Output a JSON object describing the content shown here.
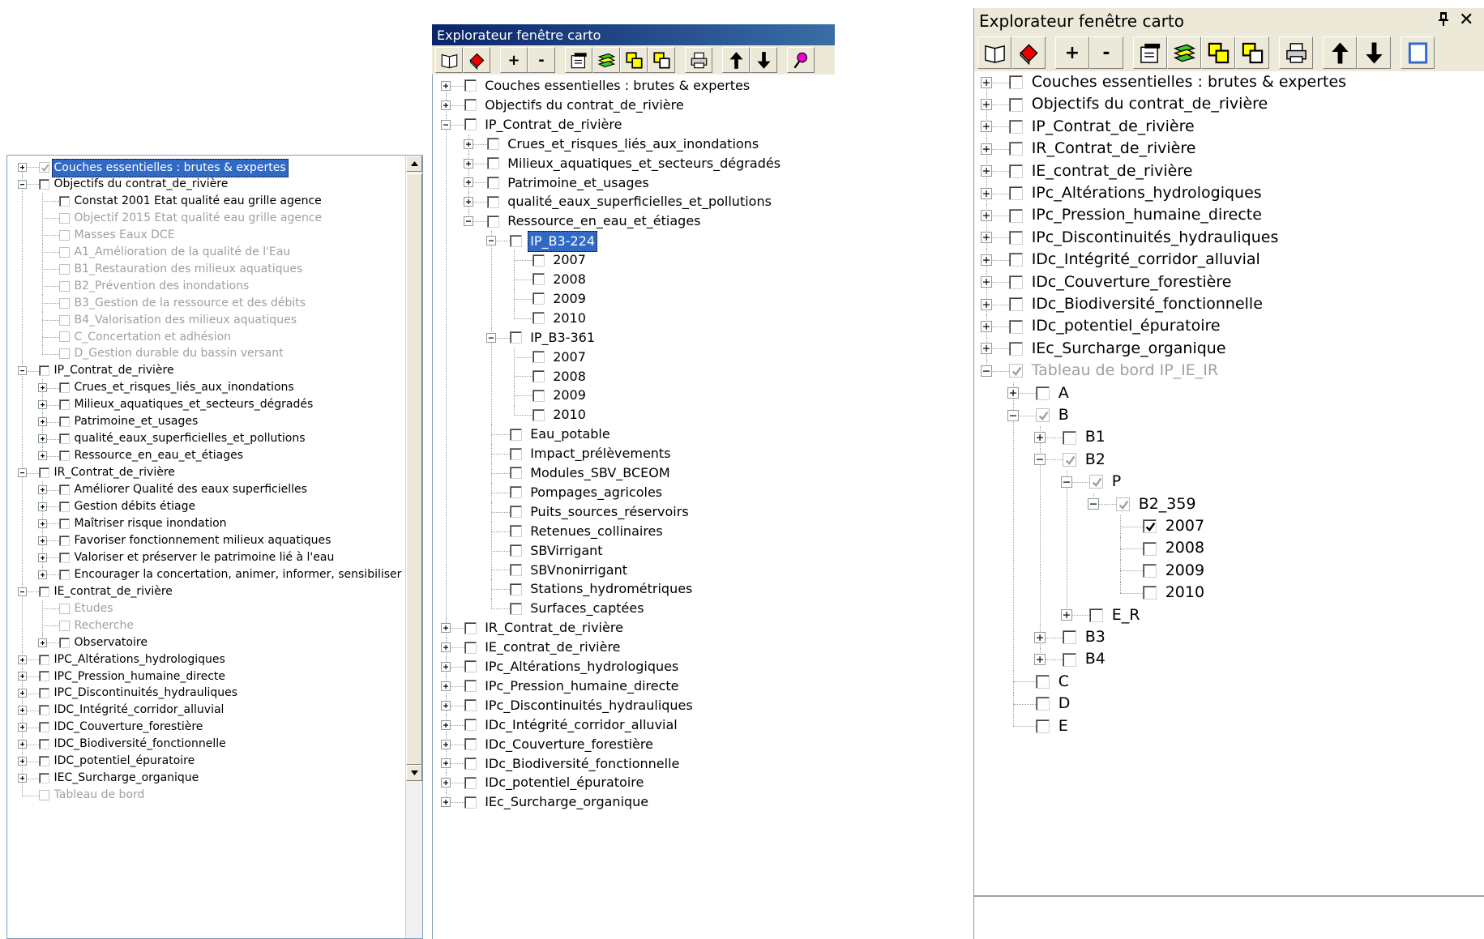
{
  "colors": {
    "titlebar_active": "#0a246a",
    "titlebar_gradient_end": "#3a6ea5",
    "selection": "#316ac5",
    "disabled_text": "#a0a0a0",
    "panel_bg": "#ece9d8"
  },
  "panel1": {
    "items": [
      {
        "level": 0,
        "exp": "+",
        "checked": "dis",
        "label": "Couches essentielles : brutes & expertes",
        "selected": true
      },
      {
        "level": 0,
        "exp": "-",
        "checked": false,
        "label": "Objectifs du contrat_de_rivière"
      },
      {
        "level": 1,
        "exp": "",
        "checked": false,
        "label": "Constat 2001 Etat qualité eau grille agence"
      },
      {
        "level": 1,
        "exp": "",
        "checked": "dis",
        "label": "Objectif 2015 Etat qualité eau grille agence",
        "disabled": true
      },
      {
        "level": 1,
        "exp": "",
        "checked": "dis",
        "label": "Masses Eaux DCE",
        "disabled": true
      },
      {
        "level": 1,
        "exp": "",
        "checked": "dis",
        "label": "A1_Amélioration de la qualité de l'Eau",
        "disabled": true
      },
      {
        "level": 1,
        "exp": "",
        "checked": "dis",
        "label": "B1_Restauration des milieux aquatiques",
        "disabled": true
      },
      {
        "level": 1,
        "exp": "",
        "checked": "dis",
        "label": "B2_Prévention des inondations",
        "disabled": true
      },
      {
        "level": 1,
        "exp": "",
        "checked": "dis",
        "label": "B3_Gestion de la ressource et des débits",
        "disabled": true
      },
      {
        "level": 1,
        "exp": "",
        "checked": "dis",
        "label": "B4_Valorisation des milieux aquatiques",
        "disabled": true
      },
      {
        "level": 1,
        "exp": "",
        "checked": "dis",
        "label": "C_Concertation et adhésion",
        "disabled": true
      },
      {
        "level": 1,
        "exp": "",
        "checked": "dis",
        "label": "D_Gestion durable du bassin versant",
        "disabled": true
      },
      {
        "level": 0,
        "exp": "-",
        "checked": false,
        "label": "IP_Contrat_de_rivière"
      },
      {
        "level": 1,
        "exp": "+",
        "checked": false,
        "label": "Crues_et_risques_liés_aux_inondations"
      },
      {
        "level": 1,
        "exp": "+",
        "checked": false,
        "label": "Milieux_aquatiques_et_secteurs_dégradés"
      },
      {
        "level": 1,
        "exp": "+",
        "checked": false,
        "label": "Patrimoine_et_usages"
      },
      {
        "level": 1,
        "exp": "+",
        "checked": false,
        "label": "qualité_eaux_superficielles_et_pollutions"
      },
      {
        "level": 1,
        "exp": "+",
        "checked": false,
        "label": "Ressource_en_eau_et_étiages"
      },
      {
        "level": 0,
        "exp": "-",
        "checked": false,
        "label": "IR_Contrat_de_rivière"
      },
      {
        "level": 1,
        "exp": "+",
        "checked": false,
        "label": "Améliorer Qualité des eaux superficielles"
      },
      {
        "level": 1,
        "exp": "+",
        "checked": false,
        "label": "Gestion débits étiage"
      },
      {
        "level": 1,
        "exp": "+",
        "checked": false,
        "label": "Maîtriser risque inondation"
      },
      {
        "level": 1,
        "exp": "+",
        "checked": false,
        "label": "Favoriser fonctionnement milieux aquatiques"
      },
      {
        "level": 1,
        "exp": "+",
        "checked": false,
        "label": "Valoriser et préserver le patrimoine lié à l'eau"
      },
      {
        "level": 1,
        "exp": "+",
        "checked": false,
        "label": "Encourager la concertation, animer, informer, sensibiliser"
      },
      {
        "level": 0,
        "exp": "-",
        "checked": false,
        "label": "IE_contrat_de_rivière"
      },
      {
        "level": 1,
        "exp": "",
        "checked": "dis",
        "label": "Etudes",
        "disabled": true
      },
      {
        "level": 1,
        "exp": "",
        "checked": "dis",
        "label": "Recherche",
        "disabled": true
      },
      {
        "level": 1,
        "exp": "+",
        "checked": false,
        "label": "Observatoire"
      },
      {
        "level": 0,
        "exp": "+",
        "checked": false,
        "label": "IPC_Altérations_hydrologiques"
      },
      {
        "level": 0,
        "exp": "+",
        "checked": false,
        "label": "IPC_Pression_humaine_directe"
      },
      {
        "level": 0,
        "exp": "+",
        "checked": false,
        "label": "IPC_Discontinuités_hydrauliques"
      },
      {
        "level": 0,
        "exp": "+",
        "checked": false,
        "label": "IDC_Intégrité_corridor_alluvial"
      },
      {
        "level": 0,
        "exp": "+",
        "checked": false,
        "label": "IDC_Couverture_forestière"
      },
      {
        "level": 0,
        "exp": "+",
        "checked": false,
        "label": "IDC_Biodiversité_fonctionnelle"
      },
      {
        "level": 0,
        "exp": "+",
        "checked": false,
        "label": "IDC_potentiel_épuratoire"
      },
      {
        "level": 0,
        "exp": "+",
        "checked": false,
        "label": "IEC_Surcharge_organique"
      },
      {
        "level": 0,
        "exp": "",
        "checked": "dis",
        "label": "Tableau de bord",
        "disabled": true
      }
    ]
  },
  "panel2": {
    "title": "Explorateur fenêtre carto",
    "toolbar": [
      {
        "name": "book-icon",
        "label": ""
      },
      {
        "name": "eraser-icon",
        "label": ""
      },
      {
        "name": "add-button",
        "label": "+"
      },
      {
        "name": "remove-button",
        "label": "-"
      },
      {
        "name": "properties-icon",
        "label": ""
      },
      {
        "name": "layers-icon",
        "label": ""
      },
      {
        "name": "copy-icon",
        "label": ""
      },
      {
        "name": "paste-icon",
        "label": ""
      },
      {
        "name": "print-icon",
        "label": ""
      },
      {
        "name": "arrow-up-icon",
        "label": ""
      },
      {
        "name": "arrow-down-icon",
        "label": ""
      },
      {
        "name": "pin-icon",
        "label": ""
      }
    ],
    "items": [
      {
        "level": 0,
        "exp": "+",
        "checked": false,
        "label": "Couches essentielles : brutes & expertes"
      },
      {
        "level": 0,
        "exp": "+",
        "checked": false,
        "label": "Objectifs du contrat_de_rivière"
      },
      {
        "level": 0,
        "exp": "-",
        "checked": false,
        "label": "IP_Contrat_de_rivière"
      },
      {
        "level": 1,
        "exp": "+",
        "checked": false,
        "label": "Crues_et_risques_liés_aux_inondations"
      },
      {
        "level": 1,
        "exp": "+",
        "checked": false,
        "label": "Milieux_aquatiques_et_secteurs_dégradés"
      },
      {
        "level": 1,
        "exp": "+",
        "checked": false,
        "label": "Patrimoine_et_usages"
      },
      {
        "level": 1,
        "exp": "+",
        "checked": false,
        "label": "qualité_eaux_superficielles_et_pollutions"
      },
      {
        "level": 1,
        "exp": "-",
        "checked": false,
        "label": "Ressource_en_eau_et_étiages"
      },
      {
        "level": 2,
        "exp": "-",
        "checked": false,
        "label": "IP_B3-224",
        "selected": true
      },
      {
        "level": 3,
        "exp": "",
        "checked": false,
        "label": "2007"
      },
      {
        "level": 3,
        "exp": "",
        "checked": false,
        "label": "2008"
      },
      {
        "level": 3,
        "exp": "",
        "checked": false,
        "label": "2009"
      },
      {
        "level": 3,
        "exp": "",
        "checked": false,
        "label": "2010"
      },
      {
        "level": 2,
        "exp": "-",
        "checked": false,
        "label": "IP_B3-361"
      },
      {
        "level": 3,
        "exp": "",
        "checked": false,
        "label": "2007"
      },
      {
        "level": 3,
        "exp": "",
        "checked": false,
        "label": "2008"
      },
      {
        "level": 3,
        "exp": "",
        "checked": false,
        "label": "2009"
      },
      {
        "level": 3,
        "exp": "",
        "checked": false,
        "label": "2010"
      },
      {
        "level": 2,
        "exp": "",
        "checked": false,
        "label": "Eau_potable"
      },
      {
        "level": 2,
        "exp": "",
        "checked": false,
        "label": "Impact_prélèvements"
      },
      {
        "level": 2,
        "exp": "",
        "checked": false,
        "label": "Modules_SBV_BCEOM"
      },
      {
        "level": 2,
        "exp": "",
        "checked": false,
        "label": "Pompages_agricoles"
      },
      {
        "level": 2,
        "exp": "",
        "checked": false,
        "label": "Puits_sources_réservoirs"
      },
      {
        "level": 2,
        "exp": "",
        "checked": false,
        "label": "Retenues_collinaires"
      },
      {
        "level": 2,
        "exp": "",
        "checked": false,
        "label": "SBVirrigant"
      },
      {
        "level": 2,
        "exp": "",
        "checked": false,
        "label": "SBVnonirrigant"
      },
      {
        "level": 2,
        "exp": "",
        "checked": false,
        "label": "Stations_hydrométriques"
      },
      {
        "level": 2,
        "exp": "",
        "checked": false,
        "label": "Surfaces_captées"
      },
      {
        "level": 0,
        "exp": "+",
        "checked": false,
        "label": "IR_Contrat_de_rivière"
      },
      {
        "level": 0,
        "exp": "+",
        "checked": false,
        "label": "IE_contrat_de_rivière"
      },
      {
        "level": 0,
        "exp": "+",
        "checked": false,
        "label": "IPc_Altérations_hydrologiques"
      },
      {
        "level": 0,
        "exp": "+",
        "checked": false,
        "label": "IPc_Pression_humaine_directe"
      },
      {
        "level": 0,
        "exp": "+",
        "checked": false,
        "label": "IPc_Discontinuités_hydrauliques"
      },
      {
        "level": 0,
        "exp": "+",
        "checked": false,
        "label": "IDc_Intégrité_corridor_alluvial"
      },
      {
        "level": 0,
        "exp": "+",
        "checked": false,
        "label": "IDc_Couverture_forestière"
      },
      {
        "level": 0,
        "exp": "+",
        "checked": false,
        "label": "IDc_Biodiversité_fonctionnelle"
      },
      {
        "level": 0,
        "exp": "+",
        "checked": false,
        "label": "IDc_potentiel_épuratoire"
      },
      {
        "level": 0,
        "exp": "+",
        "checked": false,
        "label": "IEc_Surcharge_organique"
      }
    ]
  },
  "panel3": {
    "title": "Explorateur fenêtre carto",
    "pin_glyph": "ᵖ",
    "close_glyph": "✕",
    "toolbar": [
      {
        "name": "book-icon",
        "label": ""
      },
      {
        "name": "eraser-icon",
        "label": ""
      },
      {
        "name": "add-button",
        "label": "+"
      },
      {
        "name": "remove-button",
        "label": "-"
      },
      {
        "name": "properties-icon",
        "label": ""
      },
      {
        "name": "layers-icon",
        "label": ""
      },
      {
        "name": "copy-icon",
        "label": ""
      },
      {
        "name": "paste-icon",
        "label": ""
      },
      {
        "name": "print-icon",
        "label": ""
      },
      {
        "name": "arrow-up-icon",
        "label": ""
      },
      {
        "name": "arrow-down-icon",
        "label": ""
      },
      {
        "name": "select-icon",
        "label": ""
      }
    ],
    "items": [
      {
        "level": 0,
        "exp": "+",
        "checked": false,
        "label": "Couches essentielles : brutes & expertes"
      },
      {
        "level": 0,
        "exp": "+",
        "checked": false,
        "label": "Objectifs du contrat_de_rivière"
      },
      {
        "level": 0,
        "exp": "+",
        "checked": false,
        "label": "IP_Contrat_de_rivière"
      },
      {
        "level": 0,
        "exp": "+",
        "checked": false,
        "label": "IR_Contrat_de_rivière"
      },
      {
        "level": 0,
        "exp": "+",
        "checked": false,
        "label": "IE_contrat_de_rivière"
      },
      {
        "level": 0,
        "exp": "+",
        "checked": false,
        "label": "IPc_Altérations_hydrologiques"
      },
      {
        "level": 0,
        "exp": "+",
        "checked": false,
        "label": "IPc_Pression_humaine_directe"
      },
      {
        "level": 0,
        "exp": "+",
        "checked": false,
        "label": "IPc_Discontinuités_hydrauliques"
      },
      {
        "level": 0,
        "exp": "+",
        "checked": false,
        "label": "IDc_Intégrité_corridor_alluvial"
      },
      {
        "level": 0,
        "exp": "+",
        "checked": false,
        "label": "IDc_Couverture_forestière"
      },
      {
        "level": 0,
        "exp": "+",
        "checked": false,
        "label": "IDc_Biodiversité_fonctionnelle"
      },
      {
        "level": 0,
        "exp": "+",
        "checked": false,
        "label": "IDc_potentiel_épuratoire"
      },
      {
        "level": 0,
        "exp": "+",
        "checked": false,
        "label": "IEc_Surcharge_organique"
      },
      {
        "level": 0,
        "exp": "-",
        "checked": "grey",
        "label": "Tableau de bord IP_IE_IR",
        "disabled": true
      },
      {
        "level": 1,
        "exp": "+",
        "checked": false,
        "label": "A"
      },
      {
        "level": 1,
        "exp": "-",
        "checked": "grey",
        "label": "B"
      },
      {
        "level": 2,
        "exp": "+",
        "checked": false,
        "label": "B1"
      },
      {
        "level": 2,
        "exp": "-",
        "checked": "grey",
        "label": "B2"
      },
      {
        "level": 3,
        "exp": "-",
        "checked": "grey",
        "label": "P"
      },
      {
        "level": 4,
        "exp": "-",
        "checked": "grey",
        "label": "B2_359"
      },
      {
        "level": 5,
        "exp": "",
        "checked": true,
        "label": "2007"
      },
      {
        "level": 5,
        "exp": "",
        "checked": false,
        "label": "2008"
      },
      {
        "level": 5,
        "exp": "",
        "checked": false,
        "label": "2009"
      },
      {
        "level": 5,
        "exp": "",
        "checked": false,
        "label": "2010"
      },
      {
        "level": 3,
        "exp": "+",
        "checked": false,
        "label": "E_R"
      },
      {
        "level": 2,
        "exp": "+",
        "checked": false,
        "label": "B3"
      },
      {
        "level": 2,
        "exp": "+",
        "checked": false,
        "label": "B4"
      },
      {
        "level": 1,
        "exp": "",
        "checked": false,
        "label": "C"
      },
      {
        "level": 1,
        "exp": "",
        "checked": false,
        "label": "D"
      },
      {
        "level": 1,
        "exp": "",
        "checked": false,
        "label": "E"
      }
    ]
  }
}
